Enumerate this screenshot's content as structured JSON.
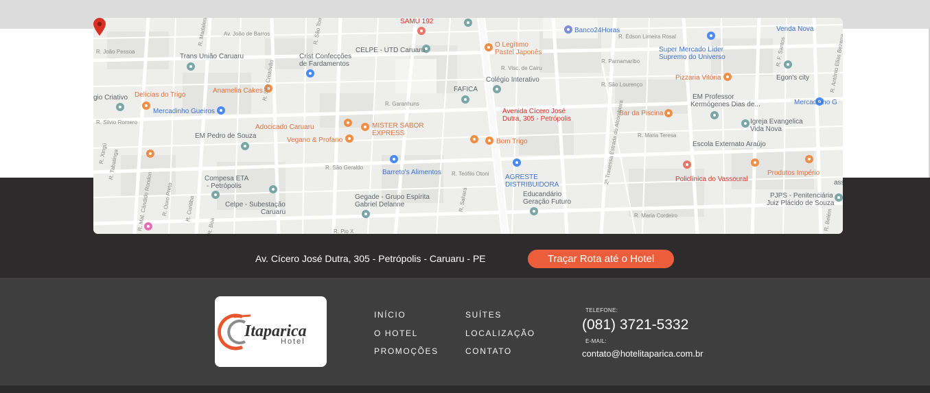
{
  "map": {
    "pin_label_line1": "Avenida Cícero José",
    "pin_label_line2": "Dutra, 305 - Petrópolis",
    "places": {
      "samu": "SAMU 192",
      "banco24": "Banco24Horas",
      "venda_nova": "Venda Nova",
      "joao_barros": "Av. João de Barros",
      "joao_pessoa": "R. João Pessoa",
      "trans_uniao": "Trans União Caruaru",
      "crist1": "Crist Confecções",
      "crist2": "de Fardamentos",
      "celpe_utd": "CELPE - UTD Caruaru",
      "legitimo1": "O Legítimo",
      "legitimo2": "Pastel Japonês",
      "edson": "R. Édson Limeira Rosal",
      "super1": "Super Mercado Líder",
      "super2": "Supremo do Universo",
      "parnamaribo": "R. Parnamaribo",
      "visc_cairu": "R. Visc. de Cairu",
      "colegio": "Colégio Interativo",
      "pizzaria": "Pizzaria Vitória",
      "egons": "Egon's city",
      "sao_lourenco": "R. São Lourenço",
      "criativo": "gio Criativo",
      "delicias": "Delícias do Trigo",
      "anamelia": "Anamelia Cakes",
      "fafica": "FAFICA",
      "em_prof1": "EM Professor",
      "em_prof2": "Kermógenes Dias de...",
      "mercadinho_g": "Mercadinho G",
      "mercadinho_gueiros": "Mercadinho Gueiros",
      "garanhuns": "R. Garanhuns",
      "bar_piscina": "Bar da Piscina",
      "igreja1": "Igreja Evangelica",
      "igreja2": "Vida Nova",
      "silvio": "R. Silvio Romero",
      "adocicado": "Adocicado Caruaru",
      "mister1": "MISTER SABOR",
      "mister2": "EXPRESS",
      "maria_teresa": "R. Maria Teresa",
      "em_pedro": "EM Pedro de Souza",
      "vegano": "Vegano & Profano",
      "bom_trigo": "Bom Trigo",
      "escola_ext": "Escola Externato Araújo",
      "sao_geraldo": "R. São Geraldo",
      "barretos": "Barreto's Alimentos",
      "teofilo": "R. Teófilo Otoni",
      "agreste1": "AGRESTE",
      "agreste2": "DISTRIBUIDORA",
      "produtos": "Produtos Império",
      "compesa1": "Compesa ETA",
      "compesa2": "- Petrópolis",
      "policlinica": "Policlínica do Vassoural",
      "ass": "ass",
      "gegade1": "Gegade - Grupo Espírita",
      "gegade2": "Gabriel Delanne",
      "educandario1": "Educandário",
      "educandario2": "Geração Futuro",
      "celpe_sub1": "Celpe - Subestação",
      "celpe_sub2": "Caruaru",
      "pjps1": "PJPS - Penitenciária",
      "pjps2": "Juiz Plácido de Souza",
      "maria_cordeiro": "R. Maria Cordeiro",
      "pio_x": "R. Pio X",
      "tabatinga": "R. Tabatinga",
      "mal_candido": "R. Mal. Cândido Rondon",
      "ouro_preto": "R. Ouro Preto",
      "curitiba": "R. Curitiba",
      "travessa": "2ª Travessa Estrada do Alcombeira",
      "xingu": "R. Xingú",
      "cristovao": "R. São Cristóvão",
      "madalena": "R. Madalena",
      "sao_tome": "R. São Tomé",
      "f_santos": "R. F. Santos",
      "antonio_elias": "R. Antônio Elias Bezerra",
      "sahara": "R. Sahara",
      "boa": "R. Boa",
      "belem": "R. Belém"
    }
  },
  "location": {
    "address": "Av. Cícero José Dutra, 305 - Petrópolis - Caruaru - PE",
    "route_button": "Traçar Rota até o Hotel"
  },
  "footer": {
    "logo_text": "Itaparica",
    "logo_subtext": "Hotel",
    "nav": {
      "inicio": "INÍCIO",
      "o_hotel": "O HOTEL",
      "promocoes": "PROMOÇÕES",
      "suites": "SUÍTES",
      "localizacao": "LOCALIZAÇÃO",
      "contato": "CONTATO"
    },
    "phone_label": "TELEFONE:",
    "phone": "(081) 3721-5332",
    "email_label": "E-MAIL:",
    "email": "contato@hotelitaparica.com.br"
  },
  "colors": {
    "accent": "#ec5e3b",
    "dark_band": "#2d2b2b",
    "footer": "#3e3e3e",
    "pin": "#d93025"
  }
}
